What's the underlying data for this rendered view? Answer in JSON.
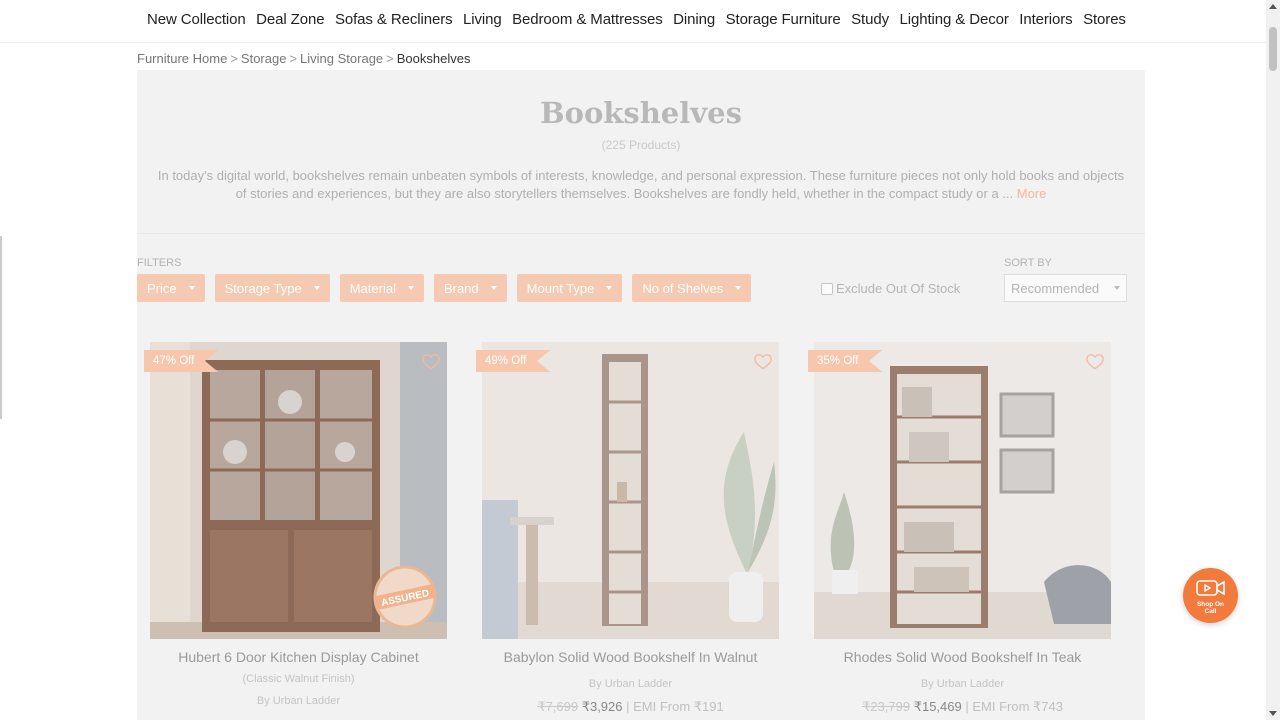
{
  "nav": {
    "items": [
      "New Collection",
      "Deal Zone",
      "Sofas & Recliners",
      "Living",
      "Bedroom & Mattresses",
      "Dining",
      "Storage Furniture",
      "Study",
      "Lighting & Decor",
      "Interiors",
      "Stores"
    ]
  },
  "breadcrumb": {
    "items": [
      "Furniture Home",
      "Storage",
      "Living Storage"
    ],
    "separator": ">",
    "current": "Bookshelves"
  },
  "header": {
    "title": "Bookshelves",
    "count": "(225 Products)",
    "intro": "In today's digital world, bookshelves remain unbeaten symbols of interests, knowledge, and personal expression. These furniture pieces not only hold books and objects of stories and experiences, but they are also storytellers themselves. Bookshelves are fondly held, whether in the compact study or a ...",
    "more": "More"
  },
  "filters": {
    "label": "FILTERS",
    "items": [
      "Price",
      "Storage Type",
      "Material",
      "Brand",
      "Mount Type",
      "No of Shelves"
    ],
    "exclude_label": "Exclude Out Of Stock",
    "exclude_checked": false
  },
  "sort": {
    "label": "SORT BY",
    "value": "Recommended"
  },
  "products": [
    {
      "badge": "47% Off",
      "title": "Hubert 6 Door Kitchen Display Cabinet",
      "finish": "(Classic Walnut Finish)",
      "brand": "By Urban Ladder",
      "old_price": "",
      "new_price": "",
      "emi": "",
      "assured": "ASSURED"
    },
    {
      "badge": "49% Off",
      "title": "Babylon Solid Wood Bookshelf In Walnut",
      "finish": "",
      "brand": "By Urban Ladder",
      "old_price": "₹7,699",
      "new_price": "₹3,926",
      "emi": "| EMI From ₹191"
    },
    {
      "badge": "35% Off",
      "title": "Rhodes Solid Wood Bookshelf In Teak",
      "finish": "",
      "brand": "By Urban Ladder",
      "old_price": "₹23,799",
      "new_price": "₹15,469",
      "emi": "| EMI From ₹743"
    }
  ],
  "shop_call": {
    "line1": "Shop On",
    "line2": "Call"
  },
  "colors": {
    "accent": "#f27a3d",
    "filter_bg": "#f5c9b2",
    "badge_bg": "#f6c6ad"
  }
}
